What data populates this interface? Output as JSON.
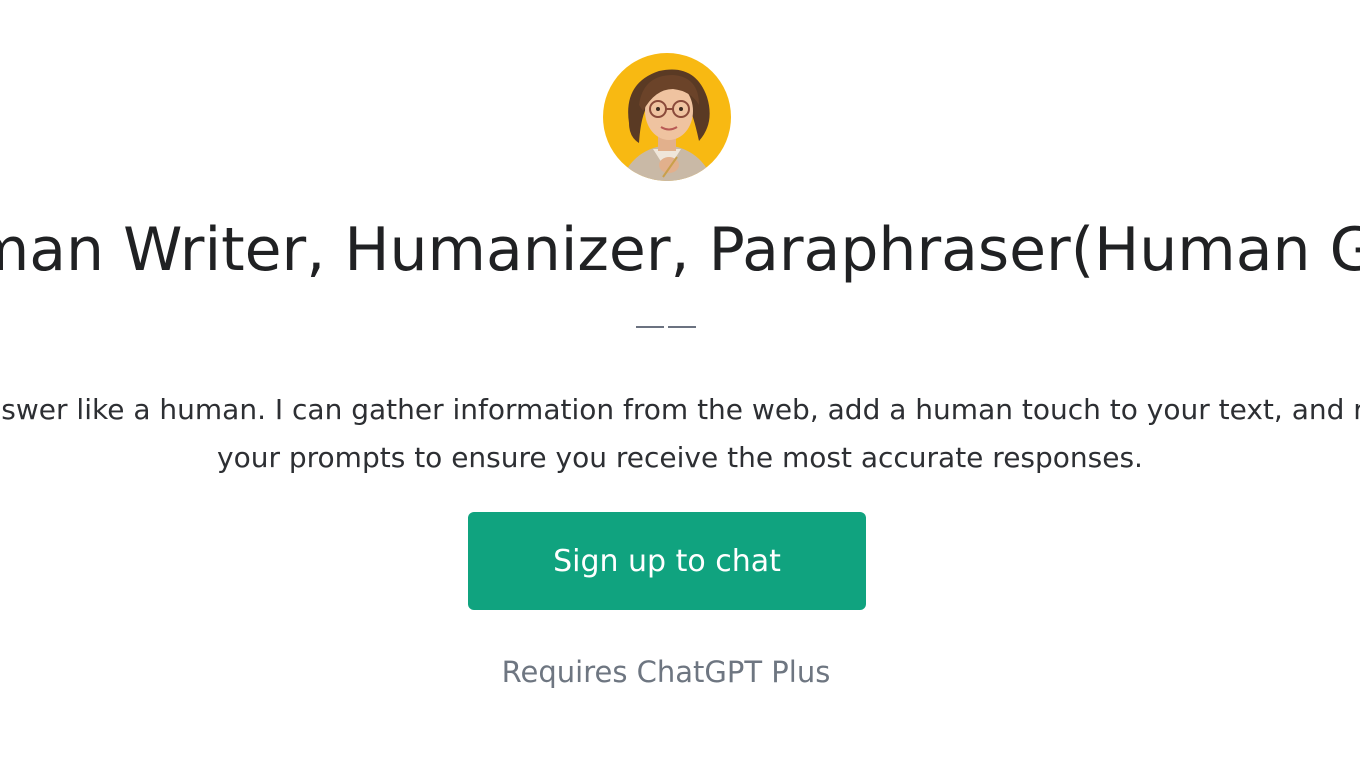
{
  "gpt": {
    "avatar_icon": "woman-portrait-avatar",
    "title": "Human Writer, Humanizer, Paraphraser(Human GPT)",
    "description_line1": "I'll answer like a human. I can gather information from the web, add a human touch to your text, and refine",
    "description_line2": "your prompts to ensure you receive the most accurate responses."
  },
  "actions": {
    "signup_label": "Sign up to chat",
    "requires_text": "Requires ChatGPT Plus"
  },
  "colors": {
    "accent": "#10a37f",
    "avatar_background": "#f8b912",
    "text_primary": "#202123",
    "text_secondary": "#6e7681"
  }
}
